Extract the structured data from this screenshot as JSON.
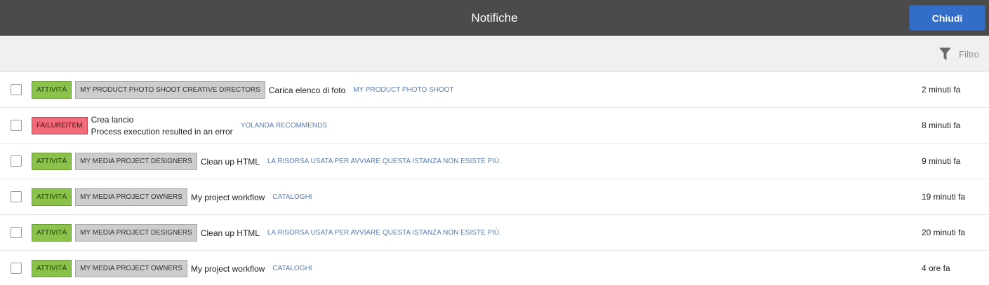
{
  "header": {
    "title": "Notifiche",
    "close_label": "Chiudi"
  },
  "toolbar": {
    "filter_label": "Filtro"
  },
  "notifications": [
    {
      "type_tag": "ATTIVITÀ",
      "group": "MY PRODUCT PHOTO SHOOT CREATIVE DIRECTORS",
      "title": "Carica elenco di foto",
      "project": "MY PRODUCT PHOTO SHOOT",
      "time": "2 minuti fa"
    },
    {
      "type_tag": "FAILUREITEM",
      "title": "Crea lancio",
      "detail": "Process execution resulted in an error",
      "project": "YOLANDA RECOMMENDS",
      "time": "8 minuti fa"
    },
    {
      "type_tag": "ATTIVITÀ",
      "group": "MY MEDIA PROJECT DESIGNERS",
      "title": "Clean up HTML",
      "project": "LA RISORSA USATA PER AVVIARE QUESTA ISTANZA NON ESISTE PIÙ.",
      "time": "9 minuti fa"
    },
    {
      "type_tag": "ATTIVITÀ",
      "group": "MY MEDIA PROJECT OWNERS",
      "title": "My project workflow",
      "project": "CATALOGHI",
      "time": "19 minuti fa"
    },
    {
      "type_tag": "ATTIVITÀ",
      "group": "MY MEDIA PROJECT DESIGNERS",
      "title": "Clean up HTML",
      "project": "LA RISORSA USATA PER AVVIARE QUESTA ISTANZA NON ESISTE PIÙ.",
      "time": "20 minuti fa"
    },
    {
      "type_tag": "ATTIVITÀ",
      "group": "MY MEDIA PROJECT OWNERS",
      "title": "My project workflow",
      "project": "CATALOGHI",
      "time": "4 ore fa"
    }
  ],
  "colors": {
    "header_bg": "#4b4b4b",
    "primary_button": "#326ec8",
    "activity_tag": "#8bc34a",
    "failure_tag": "#f26b78",
    "group_tag": "#cdcdcd",
    "project_link": "#5a7cb4"
  },
  "icons": {
    "filter": "funnel-icon"
  }
}
